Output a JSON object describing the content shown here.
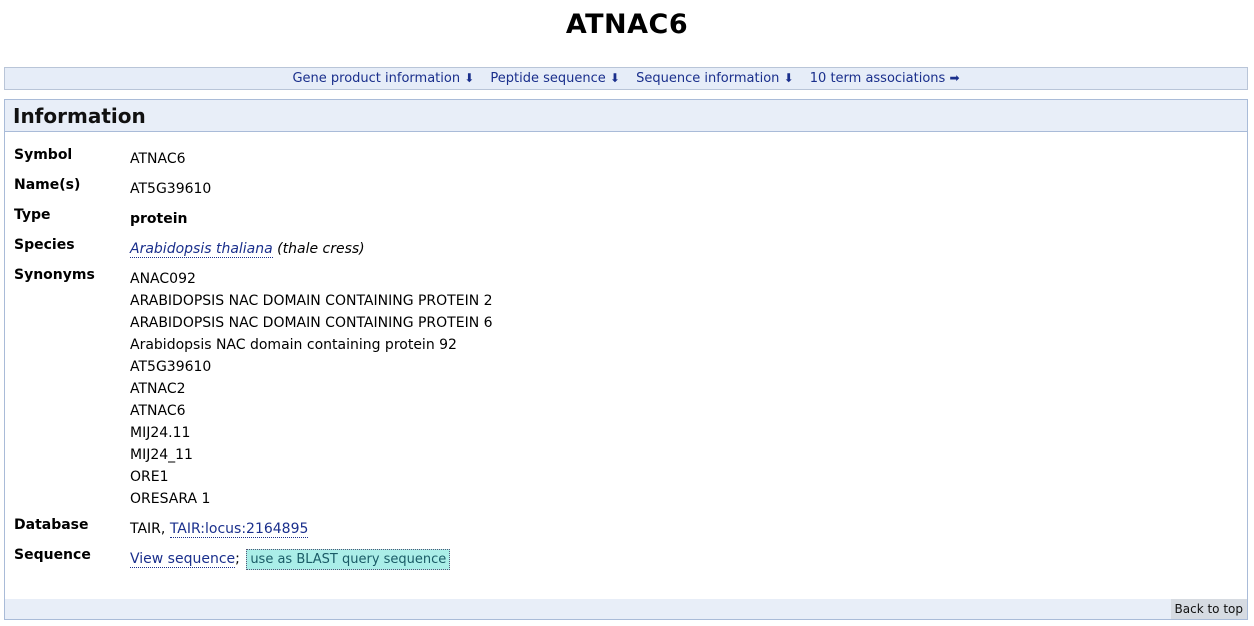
{
  "page": {
    "title": "ATNAC6"
  },
  "nav": {
    "items": [
      {
        "label": "Gene product information",
        "arrow": "⬇"
      },
      {
        "label": "Peptide sequence",
        "arrow": "⬇"
      },
      {
        "label": "Sequence information",
        "arrow": "⬇"
      },
      {
        "label": "10 term associations",
        "arrow": "➡"
      }
    ]
  },
  "info": {
    "heading": "Information",
    "symbol": {
      "label": "Symbol",
      "value": "ATNAC6"
    },
    "names": {
      "label": "Name(s)",
      "value": "AT5G39610"
    },
    "type": {
      "label": "Type",
      "value": "protein"
    },
    "species": {
      "label": "Species",
      "name": "Arabidopsis thaliana",
      "common": "(thale cress)"
    },
    "synonyms": {
      "label": "Synonyms",
      "items": [
        "ANAC092",
        "ARABIDOPSIS NAC DOMAIN CONTAINING PROTEIN 2",
        "ARABIDOPSIS NAC DOMAIN CONTAINING PROTEIN 6",
        "Arabidopsis NAC domain containing protein 92",
        "AT5G39610",
        "ATNAC2",
        "ATNAC6",
        "MIJ24.11",
        "MIJ24_11",
        "ORE1",
        "ORESARA 1"
      ]
    },
    "database": {
      "label": "Database",
      "prefix": "TAIR,",
      "link": "TAIR:locus:2164895"
    },
    "sequence": {
      "label": "Sequence",
      "view_link": "View sequence",
      "separator": ";",
      "blast_label": "use as BLAST query sequence"
    }
  },
  "footer": {
    "back_to_top": "Back to top"
  }
}
